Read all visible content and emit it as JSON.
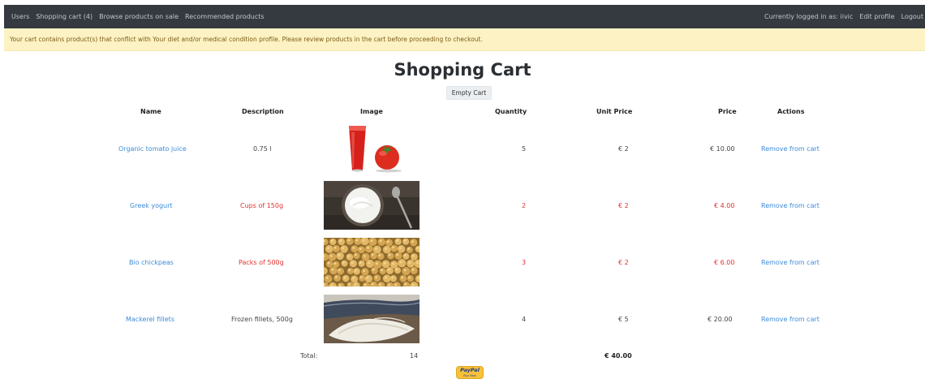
{
  "nav": {
    "users": "Users",
    "cart": "Shopping cart (4)",
    "sale": "Browse products on sale",
    "recommended": "Recommended products",
    "logged_in": "Currently logged in as: iivic",
    "edit_profile": "Edit profile",
    "logout": "Logout"
  },
  "alert": "Your cart contains product(s) that conflict with Your diet and/or medical condition profile. Please review products in the cart before proceeding to checkout.",
  "page_title": "Shopping Cart",
  "empty_cart_label": "Empty Cart",
  "columns": {
    "name": "Name",
    "description": "Description",
    "image": "Image",
    "quantity": "Quantity",
    "unit_price": "Unit Price",
    "price": "Price",
    "actions": "Actions"
  },
  "rows": [
    {
      "name": "Organic tomato juice",
      "description": "0.75 l",
      "image": "tomato-juice",
      "quantity": "5",
      "unit_price": "€ 2",
      "price": "€ 10.00",
      "action": "Remove from cart",
      "conflict": false
    },
    {
      "name": "Greek yogurt",
      "description": "Cups of 150g",
      "image": "greek-yogurt",
      "quantity": "2",
      "unit_price": "€ 2",
      "price": "€ 4.00",
      "action": "Remove from cart",
      "conflict": true
    },
    {
      "name": "Bio chickpeas",
      "description": "Packs of 500g",
      "image": "chickpeas",
      "quantity": "3",
      "unit_price": "€ 2",
      "price": "€ 6.00",
      "action": "Remove from cart",
      "conflict": true
    },
    {
      "name": "Mackerel fillets",
      "description": "Frozen fillets, 500g",
      "image": "mackerel-fillets",
      "quantity": "4",
      "unit_price": "€ 5",
      "price": "€ 20.00",
      "action": "Remove from cart",
      "conflict": false
    }
  ],
  "total": {
    "label": "Total:",
    "quantity": "14",
    "price": "€ 40.00"
  },
  "paypal": {
    "brand": "PayPal",
    "caption": "Buy Now"
  },
  "colors": {
    "navbar": "#343a40",
    "alert_bg": "#fdf2c3",
    "link": "#3d8bd9",
    "conflict": "#e03131",
    "paypal": "#f8c13a"
  }
}
